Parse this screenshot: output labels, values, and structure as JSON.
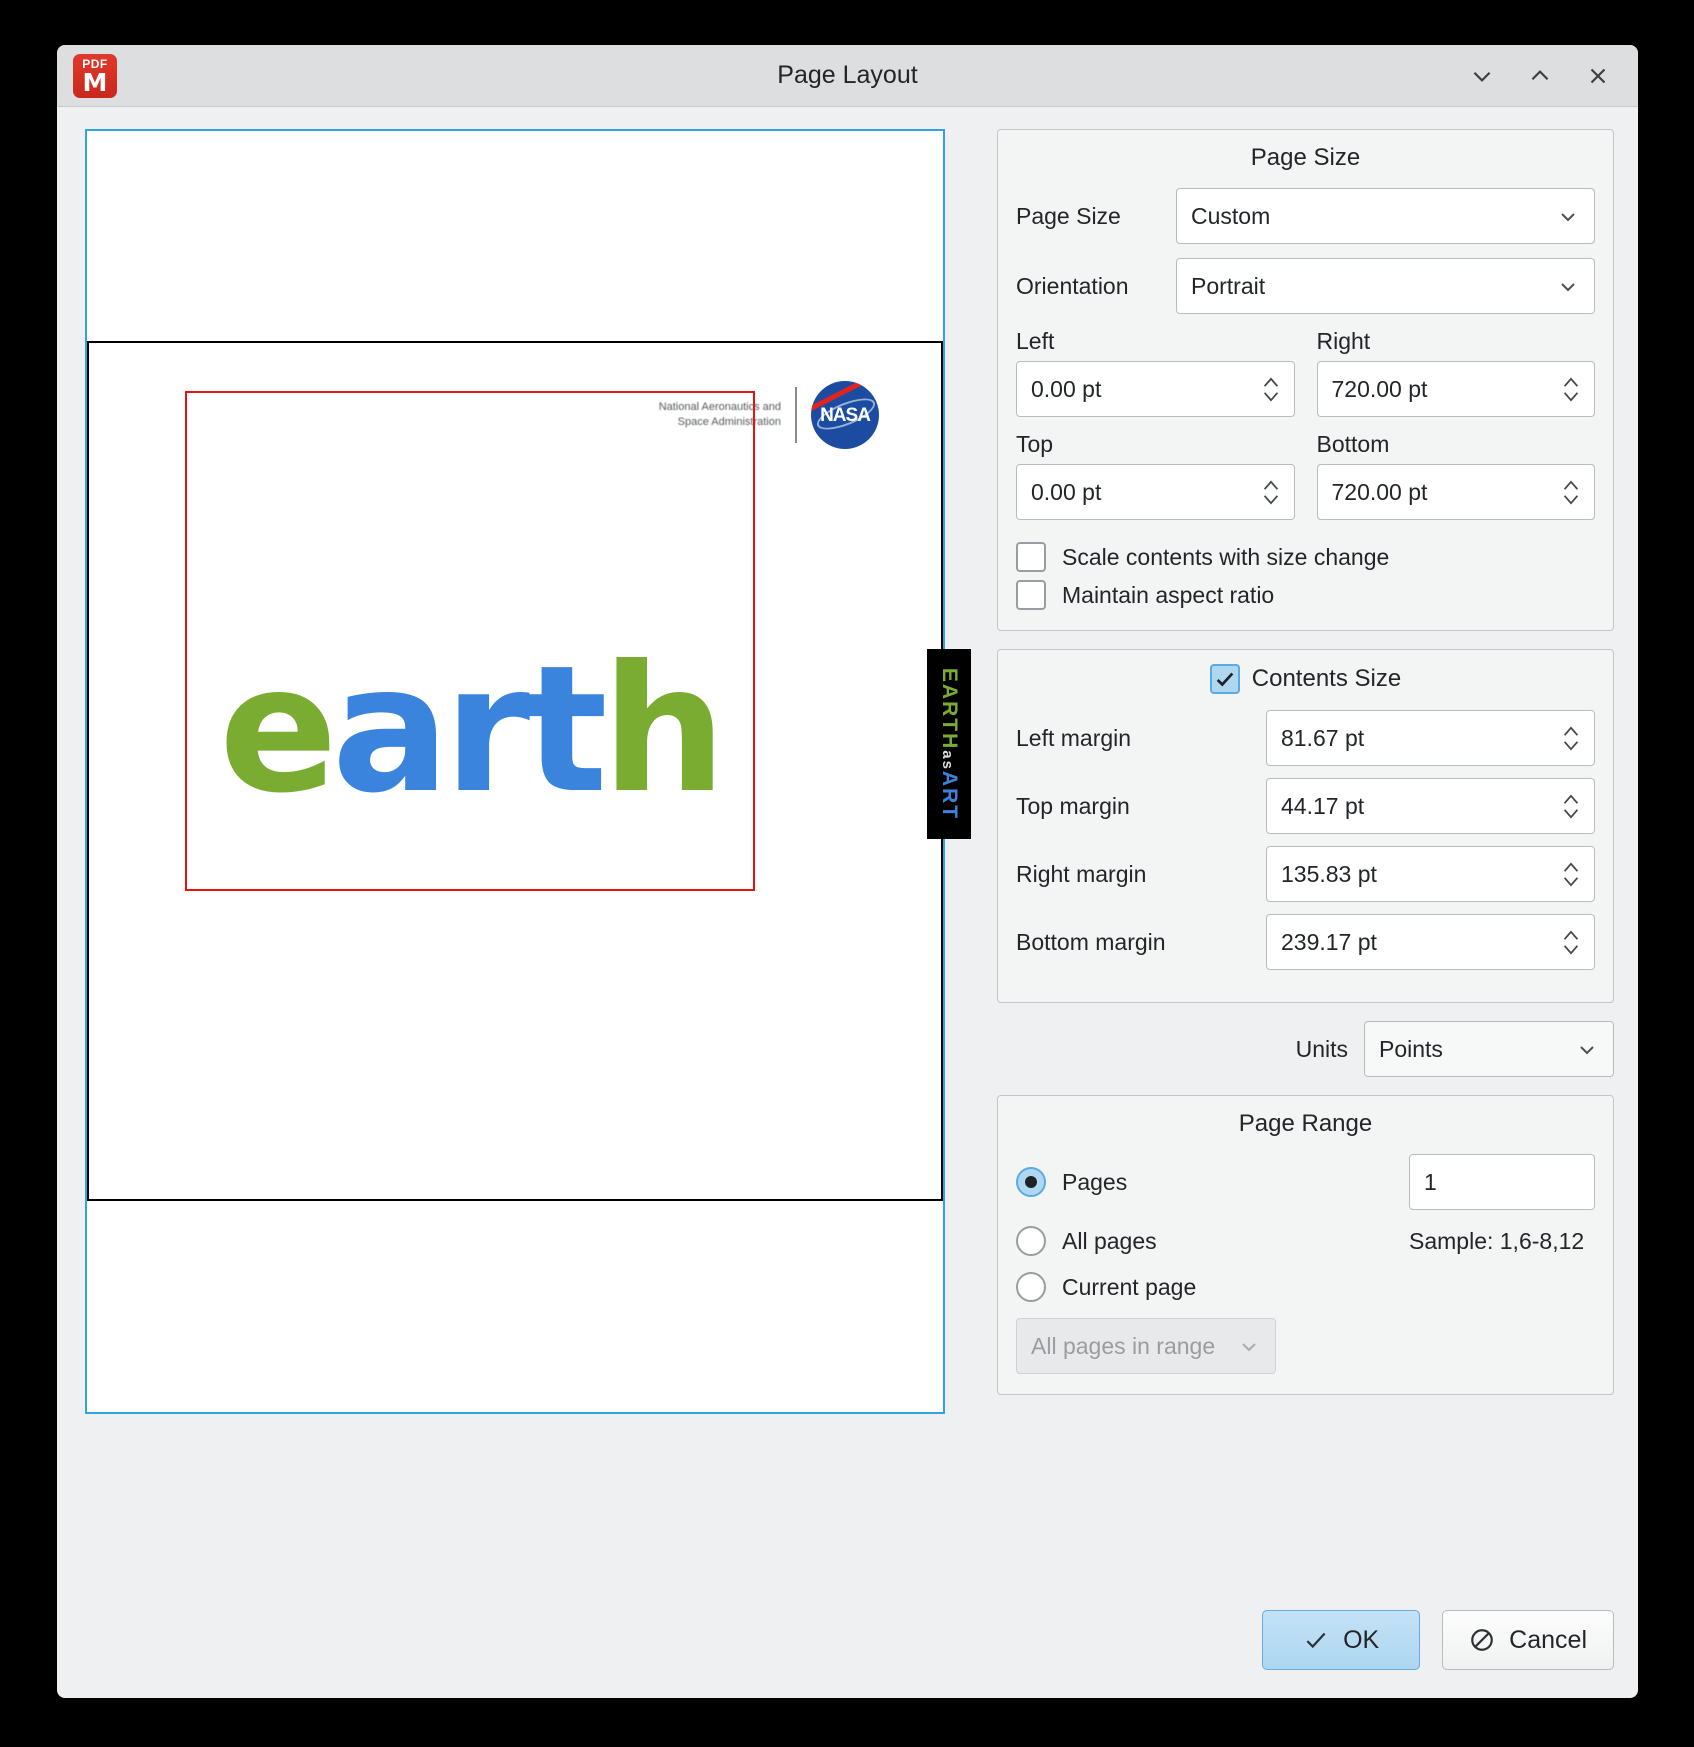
{
  "window": {
    "title": "Page Layout",
    "app_icon_label": "PDF",
    "app_icon_glyph": "M",
    "controls": {
      "minimize": "chevron-down",
      "maximize": "chevron-up",
      "close": "close"
    }
  },
  "preview": {
    "nasa_line1": "National Aeronautics and",
    "nasa_line2": "Space Administration",
    "nasa_logo_word": "NASA",
    "earth_part1": "e",
    "earth_part2": "art",
    "earth_part3": "h",
    "side_tab_earth": "EARTH",
    "side_tab_as": "as",
    "side_tab_art": "ART",
    "colors": {
      "green": "#7aac32",
      "blue": "#3b84dd",
      "content_rect": "#e11414",
      "page_outline": "#2fa4e0",
      "inner_page_outline": "#000000"
    }
  },
  "page_size": {
    "group_title": "Page Size",
    "page_size_label": "Page Size",
    "page_size_value": "Custom",
    "orientation_label": "Orientation",
    "orientation_value": "Portrait",
    "left_label": "Left",
    "left_value": "0.00 pt",
    "right_label": "Right",
    "right_value": "720.00 pt",
    "top_label": "Top",
    "top_value": "0.00 pt",
    "bottom_label": "Bottom",
    "bottom_value": "720.00 pt",
    "scale_contents_label": "Scale contents with size change",
    "scale_contents_checked": false,
    "maintain_ratio_label": "Maintain aspect ratio",
    "maintain_ratio_checked": false
  },
  "contents_size": {
    "group_title": "Contents Size",
    "checked": true,
    "left_margin_label": "Left margin",
    "left_margin_value": "81.67 pt",
    "top_margin_label": "Top margin",
    "top_margin_value": "44.17 pt",
    "right_margin_label": "Right margin",
    "right_margin_value": "135.83 pt",
    "bottom_margin_label": "Bottom margin",
    "bottom_margin_value": "239.17 pt"
  },
  "units": {
    "label": "Units",
    "value": "Points"
  },
  "page_range": {
    "group_title": "Page Range",
    "pages_label": "Pages",
    "pages_selected": true,
    "pages_value": "1",
    "all_pages_label": "All pages",
    "all_pages_selected": false,
    "sample_text": "Sample: 1,6-8,12",
    "current_page_label": "Current page",
    "current_page_selected": false,
    "range_filter_value": "All pages in range",
    "range_filter_disabled": true
  },
  "footer": {
    "ok_label": "OK",
    "cancel_label": "Cancel"
  }
}
